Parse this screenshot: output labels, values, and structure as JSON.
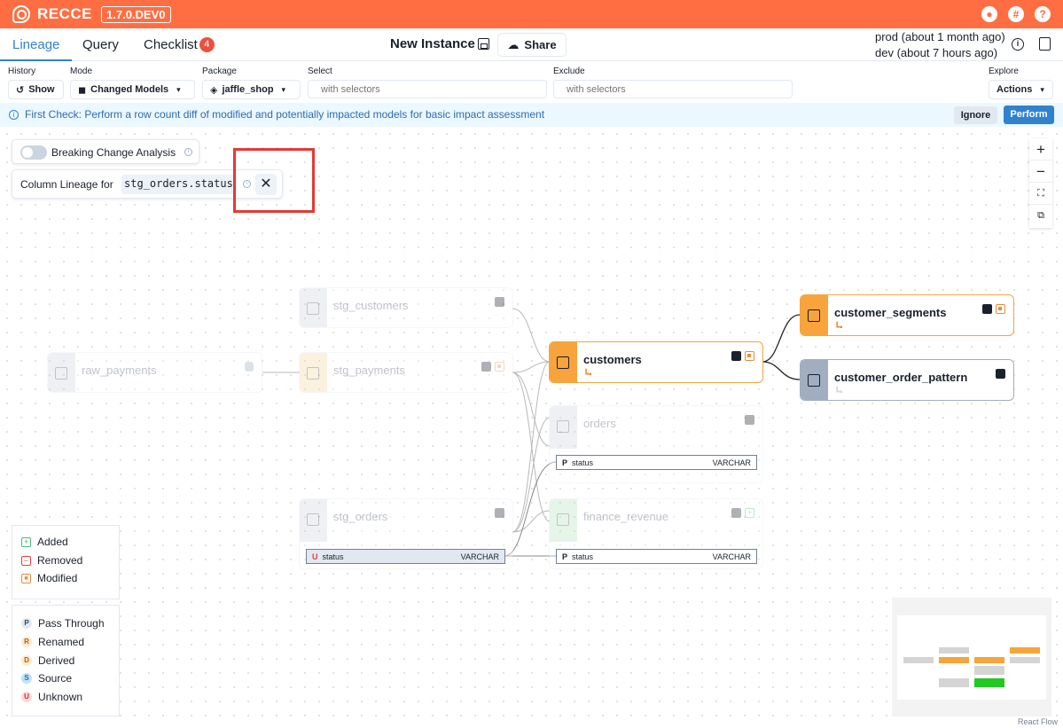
{
  "app": {
    "brand": "RECCE",
    "version": "1.7.0.DEV0"
  },
  "nav": {
    "tabs": [
      {
        "label": "Lineage"
      },
      {
        "label": "Query"
      },
      {
        "label": "Checklist",
        "badge": "4"
      }
    ],
    "instance_title": "New Instance",
    "share_label": "Share",
    "env_prod": "prod (about 1 month ago)",
    "env_dev": "dev (about 7 hours ago)"
  },
  "toolbar": {
    "history_label": "History",
    "history_btn": "Show",
    "mode_label": "Mode",
    "mode_value": "Changed Models",
    "package_label": "Package",
    "package_value": "jaffle_shop",
    "select_label": "Select",
    "select_placeholder": "with selectors",
    "exclude_label": "Exclude",
    "exclude_placeholder": "with selectors",
    "explore_label": "Explore",
    "actions_label": "Actions"
  },
  "banner": {
    "text": "First Check: Perform a row count diff of modified and potentially impacted models for basic impact assessment",
    "ignore": "Ignore",
    "perform": "Perform"
  },
  "canvas": {
    "breaking_change_label": "Breaking Change Analysis",
    "column_lineage_label": "Column Lineage for",
    "column_lineage_target": "stg_orders.status",
    "zoom": [
      "+",
      "−",
      "⛶",
      "⧉"
    ]
  },
  "nodes": {
    "stg_customers": "stg_customers",
    "raw_payments": "raw_payments",
    "stg_payments": "stg_payments",
    "customers": "customers",
    "orders": "orders",
    "stg_orders": "stg_orders",
    "finance_revenue": "finance_revenue",
    "customer_segments": "customer_segments",
    "customer_order_pattern": "customer_order_pattern"
  },
  "columns": {
    "orders_status": {
      "badge": "P",
      "name": "status",
      "type": "VARCHAR"
    },
    "stg_orders_status": {
      "badge": "U",
      "name": "status",
      "type": "VARCHAR"
    },
    "finance_status": {
      "badge": "P",
      "name": "status",
      "type": "VARCHAR"
    }
  },
  "legend": {
    "change": [
      "Added",
      "Removed",
      "Modified"
    ],
    "transform": [
      {
        "code": "P",
        "label": "Pass Through"
      },
      {
        "code": "R",
        "label": "Renamed"
      },
      {
        "code": "D",
        "label": "Derived"
      },
      {
        "code": "S",
        "label": "Source"
      },
      {
        "code": "U",
        "label": "Unknown"
      }
    ]
  },
  "colors": {
    "brand": "#ff6e42",
    "accent": "#3182ce",
    "modified": "#f6a43b",
    "added": "#48bb78"
  },
  "attribution": "React Flow"
}
